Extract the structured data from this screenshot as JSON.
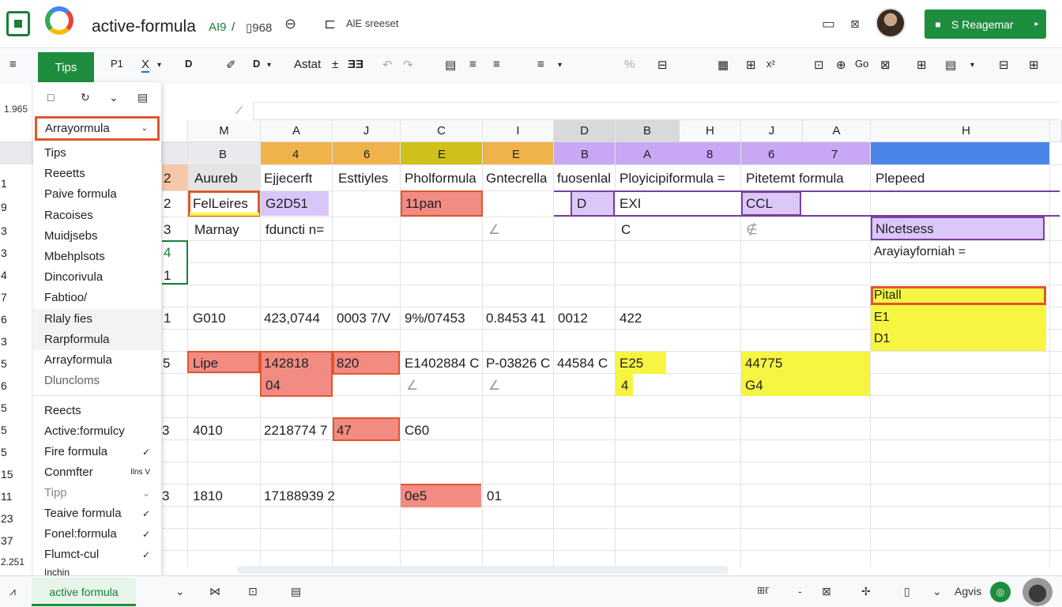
{
  "titlebar": {
    "title": "active-formula",
    "meta1": "AI9",
    "meta2": "/",
    "meta3": "▯968",
    "meta4": "AlE sreeset",
    "share_label": "S Reagemar"
  },
  "toolbar": {
    "tips_label": "Tips",
    "font_label": "Astat",
    "tools": [
      "≡",
      "P1",
      "X",
      "D",
      "✐",
      "D",
      "±",
      "ƎƎ",
      "↶",
      "↷",
      "▤",
      "≡",
      "≡",
      "≡",
      "%",
      "⊟",
      "▦",
      "⊞",
      "x²",
      "⊡",
      "⊕",
      "Go",
      "⊠",
      "⊞",
      "▤",
      "⊟",
      "⊞"
    ]
  },
  "formula_bar": {
    "name_box": "1.965",
    "fx_icon": "⟋"
  },
  "colors": {
    "green": "#1e8e3e",
    "orange_fill": "#f0b24a",
    "yellow_fill": "#f5f542",
    "purple_fill": "#c8a8f4",
    "red_fill": "#f28b82",
    "blue_fill": "#4a86e8"
  },
  "column_headers": [
    "M",
    "A",
    "J",
    "C",
    "I",
    "D",
    "B",
    "H",
    "J",
    "A",
    "H"
  ],
  "row_headers": [
    "1",
    "9",
    "3",
    "3",
    "4",
    "7",
    "6",
    "3",
    "5",
    "6",
    "5",
    "5",
    "5",
    "15",
    "11",
    "23",
    "37",
    "2.251"
  ],
  "color_band": [
    "B",
    "4",
    "6",
    "E",
    "E",
    "B",
    "A",
    "8",
    "6",
    "7"
  ],
  "cells": {
    "r1": [
      "2",
      "Auureb",
      "Ejjecerft",
      "Esttiyles",
      "Pholformula",
      "Gntecrella",
      "fuosenlal",
      "Ployicipiformula =",
      "Pitetemt formula",
      "Plepeed"
    ],
    "r2": [
      "2",
      "FelLeires",
      "G2D51",
      "11pan",
      "D",
      "EXI",
      "CCL"
    ],
    "r3": [
      "3",
      "Marnay",
      "fduncti n=",
      "∠",
      "C",
      "∉",
      "Nlcetsess"
    ],
    "r3b": [
      "Arayiayforniah ="
    ],
    "r4": [
      "4"
    ],
    "r5": [
      "1"
    ],
    "pitall": "Pitall",
    "r6": [
      "1",
      "G010",
      "423,0744",
      "0003 7/V",
      "9%/07453",
      "0.8453 41",
      "0012",
      "422",
      "E1"
    ],
    "r6b": [
      "D1"
    ],
    "r7": [
      "5",
      "Lipe",
      "142818",
      "820",
      "E1402884 C",
      "P-03826 C",
      "44584 C",
      "E25",
      "44775"
    ],
    "r7b": [
      "04",
      "∠",
      "∠",
      "4",
      "G4"
    ],
    "r8": [
      "3",
      "4010",
      "2218774 7",
      "47",
      "C60"
    ],
    "r9": [
      "3",
      "1810",
      "17188939 2",
      "0e5",
      "01"
    ]
  },
  "menu": {
    "selected": "Arrayormula",
    "items": [
      {
        "label": "Tips"
      },
      {
        "label": "Reeetts"
      },
      {
        "label": "Paive formula"
      },
      {
        "label": "Racoises"
      },
      {
        "label": "Muidjsebs"
      },
      {
        "label": "Mbehplsots"
      },
      {
        "label": "Dincorivula"
      },
      {
        "label": "Fabtioo/"
      },
      {
        "label": "Rlaly fies"
      },
      {
        "label": "Rarpformula"
      },
      {
        "label": "Arrayformula"
      },
      {
        "label": "Dluncloms"
      },
      {
        "label": "Reects"
      },
      {
        "label": "Active:formulcy"
      },
      {
        "label": "Fire formula",
        "right": "✓"
      },
      {
        "label": "Conmfter",
        "right": "Ilns V"
      },
      {
        "label": "Tipp",
        "right": "⌄"
      },
      {
        "label": "Teaive formula",
        "right": "✓"
      },
      {
        "label": "Fonel:formula",
        "right": "✓"
      },
      {
        "label": "Flumct-cul",
        "right": "✓"
      },
      {
        "label": "Inchin"
      }
    ]
  },
  "bottom": {
    "sheet_tab": "active formula",
    "right_label": "Agvis",
    "icons": [
      "⩘",
      "⌄",
      "⋈",
      "⊡",
      "▤",
      "⊞ℓ̈",
      "-",
      "⊠",
      "✢",
      "▯",
      "⌄"
    ]
  }
}
